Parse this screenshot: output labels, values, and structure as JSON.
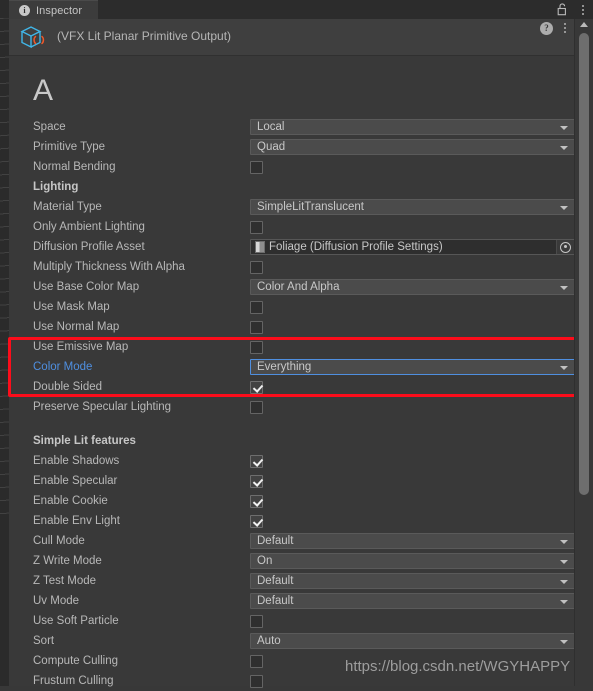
{
  "window": {
    "tab_label": "Inspector",
    "tab_icon": "info-icon",
    "lock_icon": "unlocked-padlock-icon",
    "menu_icon": "kebab-menu-icon"
  },
  "component": {
    "icon": "vfx-graph-cube-icon",
    "title": "(VFX Lit Planar Primitive Output)",
    "help_icon": "help-question-icon",
    "menu_icon": "kebab-menu-icon"
  },
  "content": {
    "heading": "A",
    "highlight_color": "#fc0d1b",
    "accent_color": "#4f8fe0"
  },
  "rows": [
    {
      "label": "Space",
      "type": "dropdown",
      "value": "Local"
    },
    {
      "label": "Primitive Type",
      "type": "dropdown",
      "value": "Quad"
    },
    {
      "label": "Normal Bending",
      "type": "checkbox",
      "checked": false
    },
    {
      "label": "Lighting",
      "type": "section"
    },
    {
      "label": "Material Type",
      "type": "dropdown",
      "value": "SimpleLitTranslucent"
    },
    {
      "label": "Only Ambient Lighting",
      "type": "checkbox",
      "checked": false
    },
    {
      "label": "Diffusion Profile Asset",
      "type": "object",
      "value": "Foliage (Diffusion Profile Settings)"
    },
    {
      "label": "Multiply Thickness With Alpha",
      "type": "checkbox",
      "checked": false
    },
    {
      "label": "Use Base Color Map",
      "type": "dropdown",
      "value": "Color And Alpha"
    },
    {
      "label": "Use Mask Map",
      "type": "checkbox",
      "checked": false
    },
    {
      "label": "Use Normal Map",
      "type": "checkbox",
      "checked": false
    },
    {
      "label": "Use Emissive Map",
      "type": "checkbox",
      "checked": false
    },
    {
      "label": "Color Mode",
      "type": "dropdown",
      "value": "Everything",
      "focused": true,
      "label_highlighted": true
    },
    {
      "label": "Double Sided",
      "type": "checkbox",
      "checked": true
    },
    {
      "label": "Preserve Specular Lighting",
      "type": "checkbox",
      "checked": false
    },
    {
      "label": "",
      "type": "gap"
    },
    {
      "label": "Simple Lit features",
      "type": "section"
    },
    {
      "label": "Enable Shadows",
      "type": "checkbox",
      "checked": true
    },
    {
      "label": "Enable Specular",
      "type": "checkbox",
      "checked": true
    },
    {
      "label": "Enable Cookie",
      "type": "checkbox",
      "checked": true
    },
    {
      "label": "Enable Env Light",
      "type": "checkbox",
      "checked": true
    },
    {
      "label": "Cull Mode",
      "type": "dropdown",
      "value": "Default"
    },
    {
      "label": "Z Write Mode",
      "type": "dropdown",
      "value": "On"
    },
    {
      "label": "Z Test Mode",
      "type": "dropdown",
      "value": "Default"
    },
    {
      "label": "Uv Mode",
      "type": "dropdown",
      "value": "Default"
    },
    {
      "label": "Use Soft Particle",
      "type": "checkbox",
      "checked": false
    },
    {
      "label": "Sort",
      "type": "dropdown",
      "value": "Auto"
    },
    {
      "label": "Compute Culling",
      "type": "checkbox",
      "checked": false
    },
    {
      "label": "Frustum Culling",
      "type": "checkbox",
      "checked": false
    }
  ],
  "watermark": "https://blog.csdn.net/WGYHAPPY"
}
